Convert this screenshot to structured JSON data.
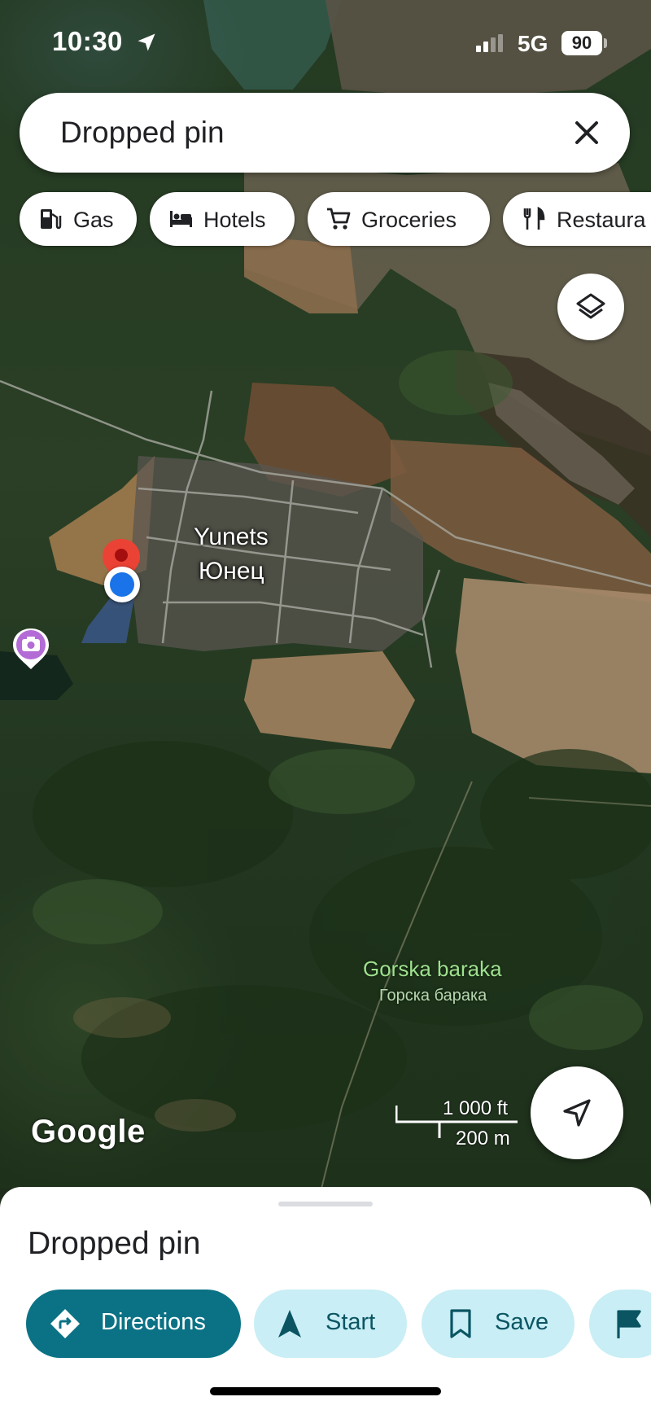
{
  "status_bar": {
    "time": "10:30",
    "network": "5G",
    "battery": "90",
    "icons": [
      "location-arrow-icon",
      "signal-icon"
    ]
  },
  "search": {
    "text": "Dropped pin",
    "close_icon": "close-icon"
  },
  "chips": [
    {
      "label": "Gas",
      "icon": "gas-station-icon"
    },
    {
      "label": "Hotels",
      "icon": "bed-icon"
    },
    {
      "label": "Groceries",
      "icon": "cart-icon"
    },
    {
      "label": "Restaura",
      "icon": "fork-knife-icon"
    }
  ],
  "map": {
    "town_name": "Yunets",
    "town_name_cyrillic": "Юнец",
    "forest_name": "Gorska baraka",
    "forest_name_cyrillic": "Горска барака",
    "attribution": "Google",
    "scale_imperial": "1 000 ft",
    "scale_metric": "200 m",
    "colors": {
      "pin": "#ea4335",
      "location": "#1a73e8",
      "photo_poi": "#b36bd6",
      "forest_label": "#9fe08f"
    }
  },
  "sheet": {
    "title": "Dropped pin",
    "actions": [
      {
        "label": "Directions",
        "icon": "directions-icon"
      },
      {
        "label": "Start",
        "icon": "navigation-arrow-icon"
      },
      {
        "label": "Save",
        "icon": "bookmark-icon"
      },
      {
        "label": "",
        "icon": "flag-icon"
      }
    ],
    "colors": {
      "primary": "#0b7285",
      "secondary": "#c9eef5"
    }
  }
}
